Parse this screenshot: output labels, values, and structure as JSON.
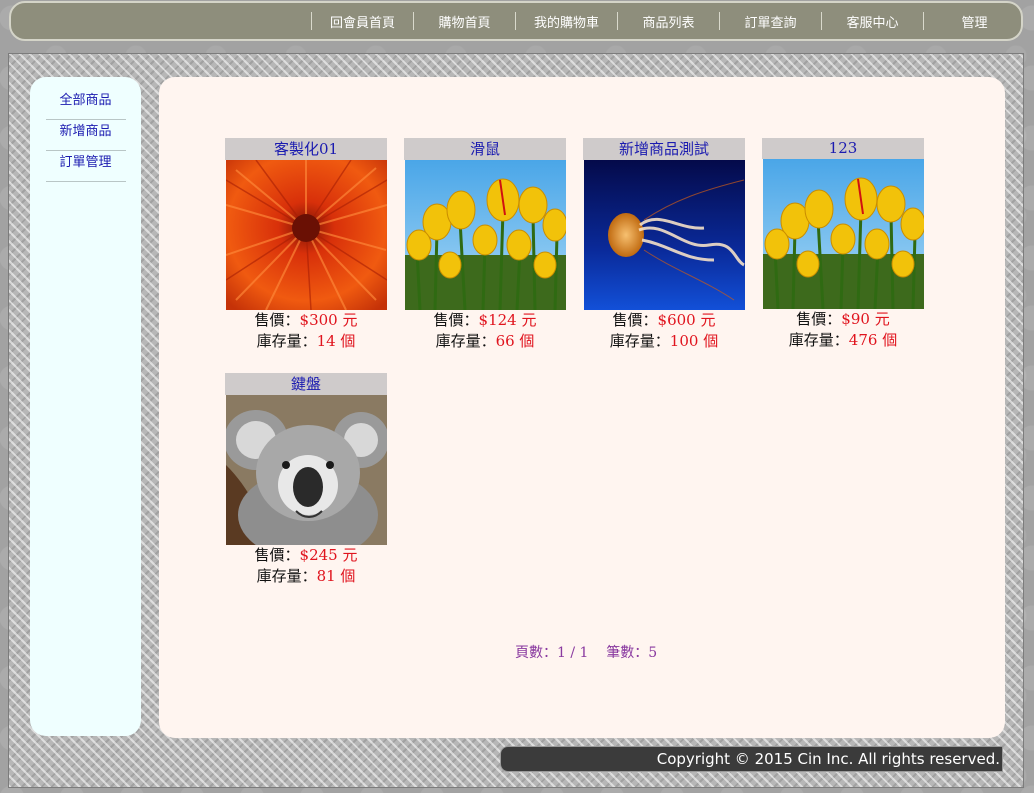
{
  "nav": {
    "items": [
      "回會員首頁",
      "購物首頁",
      "我的購物車",
      "商品列表",
      "訂單查詢",
      "客服中心",
      "管理"
    ]
  },
  "sidebar": {
    "items": [
      {
        "label": "全部商品"
      },
      {
        "label": "新增商品"
      },
      {
        "label": "訂單管理"
      }
    ]
  },
  "products": [
    {
      "name": "客製化01",
      "price_label": "售價：",
      "price": "$300 元",
      "stock_label": "庫存量：",
      "stock": "14 個",
      "image": "red-chrysanthemum"
    },
    {
      "name": "滑鼠",
      "price_label": "售價：",
      "price": "$124 元",
      "stock_label": "庫存量：",
      "stock": "66 個",
      "image": "yellow-tulips"
    },
    {
      "name": "新增商品測試",
      "price_label": "售價：",
      "price": "$600 元",
      "stock_label": "庫存量：",
      "stock": "100 個",
      "image": "jellyfish"
    },
    {
      "name": "123",
      "price_label": "售價：",
      "price": "$90 元",
      "stock_label": "庫存量：",
      "stock": "476 個",
      "image": "yellow-tulips"
    },
    {
      "name": "鍵盤",
      "price_label": "售價：",
      "price": "$245 元",
      "stock_label": "庫存量：",
      "stock": "81 個",
      "image": "koala"
    }
  ],
  "pager": {
    "text": "頁數：1 / 1    筆數：5"
  },
  "footer": {
    "copyright": "Copyright © 2015 Cin Inc. All rights reserved."
  },
  "colors": {
    "nav_bg": "#8e8e7c",
    "sidebar_bg": "#efffff",
    "content_bg": "#fff5f0",
    "link": "#1b1bb0",
    "price": "#e0141e"
  }
}
